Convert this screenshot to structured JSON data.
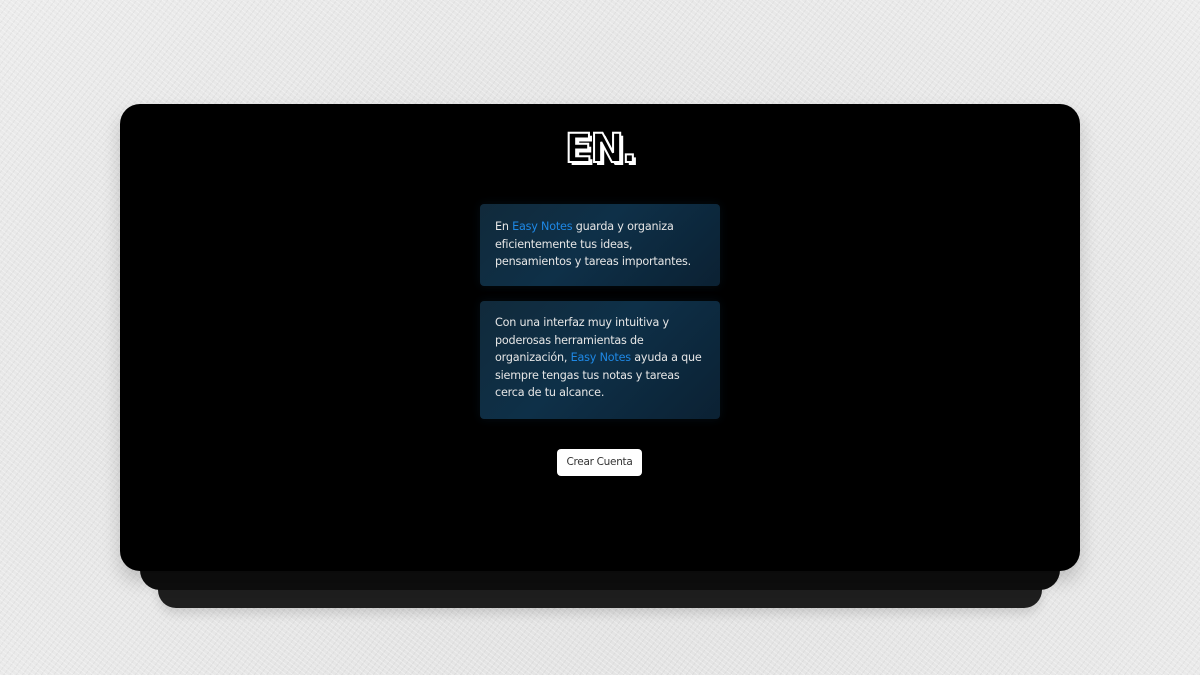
{
  "logo": {
    "text": "EN."
  },
  "cards": [
    {
      "before": "En ",
      "brand": "Easy Notes",
      "after": " guarda y organiza eficientemente tus ideas, pensamientos y tareas importantes."
    },
    {
      "before": "Con una interfaz muy intuitiva y poderosas herramientas de organización, ",
      "brand": "Easy Notes",
      "after": " ayuda a que siempre tengas tus notas y tareas cerca de tu alcance."
    }
  ],
  "actions": {
    "create_account_label": "Crear Cuenta"
  },
  "colors": {
    "brand_accent": "#1e88e5",
    "device_background": "#000000",
    "card_background": "#0e3048",
    "page_background": "#e6e6e6"
  }
}
